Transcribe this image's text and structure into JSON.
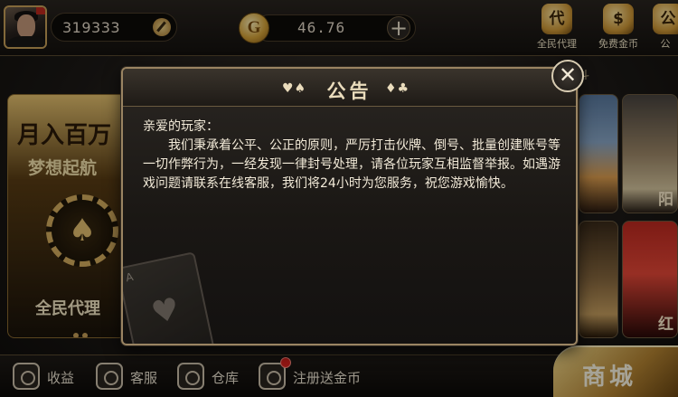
{
  "header": {
    "user_id": "319333",
    "coin_balance": "46.76",
    "plus_symbol": "+",
    "coin_symbol": "G",
    "actions": [
      {
        "label": "全民代理",
        "icon": "agent-icon",
        "glyph": "代"
      },
      {
        "label": "免费金币",
        "icon": "free-coin-icon",
        "glyph": "$"
      },
      {
        "label": "公",
        "icon": "notice-icon",
        "glyph": "公"
      }
    ]
  },
  "background": {
    "promo": {
      "title": "月入百万",
      "subtitle": "梦想起航",
      "footer": "全民代理",
      "chip_glyph": "♠"
    },
    "tab_hint": "斗",
    "tile_labels": [
      "",
      "阳",
      "",
      "红"
    ]
  },
  "dialog": {
    "title": "公告",
    "suits_left": "♥♠",
    "suits_right": "♦♣",
    "greeting": "亲爱的玩家：",
    "body": "我们秉承着公平、公正的原则，严厉打击伙牌、倒号、批量创建账号等一切作弊行为，一经发现一律封号处理，请各位玩家互相监督举报。如遇游戏问题请联系在线客服，我们将24小时为您服务，祝您游戏愉快。",
    "close_symbol": "✕",
    "card_corner": "A",
    "card_suit": "♥"
  },
  "bottom_nav": [
    {
      "label": "收益",
      "icon": "earnings-icon"
    },
    {
      "label": "客服",
      "icon": "customer-service-icon"
    },
    {
      "label": "仓库",
      "icon": "warehouse-icon"
    },
    {
      "label": "注册送金币",
      "icon": "register-gift-icon",
      "has_badge": true
    }
  ],
  "shop_label": "商城",
  "colors": {
    "accent_gold": "#c9a25a",
    "badge_red": "#e0231e",
    "dialog_text": "#f2ead8"
  }
}
